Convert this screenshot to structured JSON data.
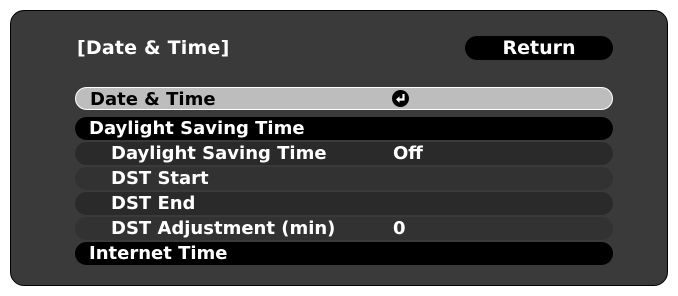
{
  "menu": {
    "title": "[Date & Time]",
    "return_label": "Return"
  },
  "rows": [
    {
      "label": "Date & Time",
      "value": "",
      "icon": "enter-icon",
      "state": "selected"
    },
    {
      "label": "Daylight Saving Time",
      "value": ""
    },
    {
      "label": "Daylight Saving Time",
      "value": "Off"
    },
    {
      "label": "DST Start",
      "value": ""
    },
    {
      "label": "DST End",
      "value": ""
    },
    {
      "label": "DST Adjustment (min)",
      "value": "0"
    },
    {
      "label": "Internet Time",
      "value": ""
    }
  ],
  "colors": {
    "panel": "#3a3a3a",
    "heading_bar": "#000000",
    "selected_bar": "#bdbdbd",
    "text": "#ffffff"
  }
}
